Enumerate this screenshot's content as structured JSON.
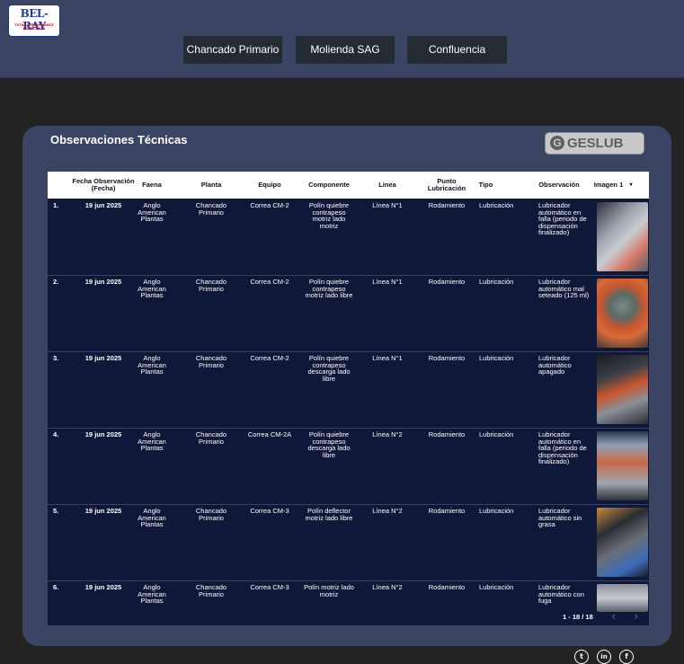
{
  "brand": {
    "logo_text": "BEL-RAY",
    "logo_sub": "TOTAL PERFORMANCE LUBRICANTS"
  },
  "nav": [
    {
      "label": "Chancado Primario"
    },
    {
      "label": "Molienda SAG"
    },
    {
      "label": "Confluencia"
    }
  ],
  "panel": {
    "title": "Observaciones Técnicas",
    "partner_logo": "GESLUB",
    "partner_logo_g": "G"
  },
  "table": {
    "headers": [
      "",
      "Fecha Observación (Fecha)",
      "Faena",
      "Planta",
      "Equipo",
      "Componente",
      "Linea",
      "Punto Lubricación",
      "Tipo",
      "Observación",
      "Imagen 1"
    ],
    "sort_icon": "▾",
    "rows": [
      {
        "n": "1.",
        "fecha": "19 jun 2025",
        "faena": "Anglo American Plantas",
        "planta": "Chancado Primario",
        "equipo": "Correa CM-2",
        "componente": "Polín quiebre contrapeso motriz lado motriz",
        "linea": "Línea N°1",
        "punto": "Rodamiento",
        "tipo": "Lubricación",
        "obs": "Lubricador automático en falla (periodo de dispensación finalizado)"
      },
      {
        "n": "2.",
        "fecha": "19 jun 2025",
        "faena": "Anglo American Plantas",
        "planta": "Chancado Primario",
        "equipo": "Correa CM-2",
        "componente": "Polín quiebre contrapeso motriz lado libre",
        "linea": "Línea N°1",
        "punto": "Rodamiento",
        "tipo": "Lubricación",
        "obs": "Lubricador automático mal seteado (125 ml)"
      },
      {
        "n": "3.",
        "fecha": "19 jun 2025",
        "faena": "Anglo American Plantas",
        "planta": "Chancado Primario",
        "equipo": "Correa CM-2",
        "componente": "Polín quiebre contrapeso descarga lado libre",
        "linea": "Línea N°1",
        "punto": "Rodamiento",
        "tipo": "Lubricación",
        "obs": "Lubricador automático apagado"
      },
      {
        "n": "4.",
        "fecha": "19 jun 2025",
        "faena": "Anglo American Plantas",
        "planta": "Chancado Primario",
        "equipo": "Correa CM-2A",
        "componente": "Polín quiebre contrapeso descarga lado libre",
        "linea": "Línea N°2",
        "punto": "Rodamiento",
        "tipo": "Lubricación",
        "obs": "Lubricador automático en falla (periodo de dispensación finalizado)"
      },
      {
        "n": "5.",
        "fecha": "19 jun 2025",
        "faena": "Anglo American Plantas",
        "planta": "Chancado Primario",
        "equipo": "Correa CM-3",
        "componente": "Polín deflector motriz lado libre",
        "linea": "Línea N°2",
        "punto": "Rodamiento",
        "tipo": "Lubricación",
        "obs": "Lubricador automático sin grasa"
      },
      {
        "n": "6.",
        "fecha": "19 jun 2025",
        "faena": "Anglo American Plantas",
        "planta": "Chancado Primario",
        "equipo": "Correa CM-3",
        "componente": "Polín motriz lado motriz",
        "linea": "Línea N°2",
        "punto": "Rodamiento",
        "tipo": "Lubricación",
        "obs": "Lubricador automático con fuga"
      }
    ],
    "pagination": {
      "label": "1 - 18 / 18",
      "prev": "‹",
      "next": "›"
    }
  },
  "social": [
    {
      "icon": "twitter-icon",
      "glyph": "t"
    },
    {
      "icon": "linkedin-icon",
      "glyph": "in"
    },
    {
      "icon": "facebook-icon",
      "glyph": "f"
    }
  ],
  "colors": {
    "header_bg": "#3b4463",
    "page_bg": "#232323",
    "table_bg": "#10183a",
    "button_bg": "#242b33"
  }
}
